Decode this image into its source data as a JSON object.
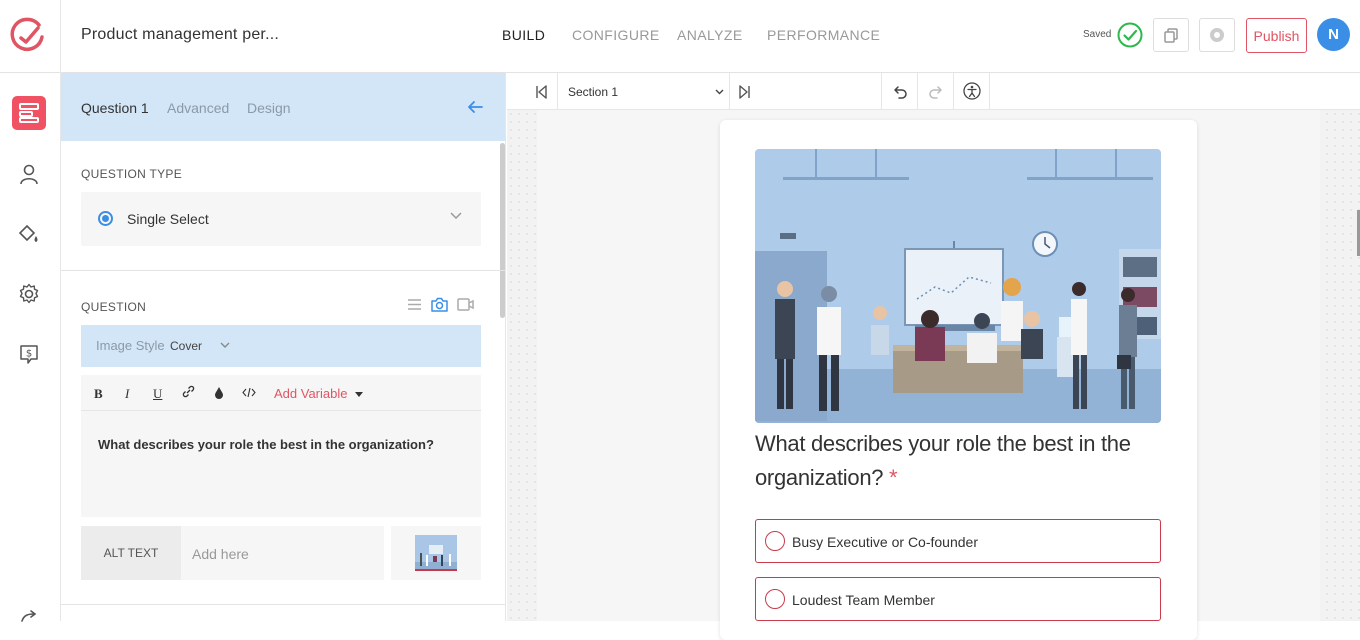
{
  "header": {
    "form_title": "Product management per...",
    "nav": [
      {
        "label": "BUILD",
        "active": true
      },
      {
        "label": "CONFIGURE",
        "active": false
      },
      {
        "label": "ANALYZE",
        "active": false
      },
      {
        "label": "PERFORMANCE",
        "active": false
      }
    ],
    "saved_label": "Saved",
    "publish_label": "Publish",
    "avatar_initial": "N"
  },
  "rail": {
    "items": [
      {
        "icon": "form-builder-icon",
        "active": true
      },
      {
        "icon": "user-icon",
        "active": false
      },
      {
        "icon": "paint-bucket-icon",
        "active": false
      },
      {
        "icon": "gear-icon",
        "active": false
      },
      {
        "icon": "pricing-icon",
        "active": false
      },
      {
        "icon": "share-icon",
        "active": false
      }
    ]
  },
  "panel": {
    "tabs": [
      {
        "label": "Question 1",
        "active": true
      },
      {
        "label": "Advanced",
        "active": false
      },
      {
        "label": "Design",
        "active": false
      }
    ],
    "question_type_label": "QUESTION TYPE",
    "question_type_value": "Single Select",
    "question_label": "QUESTION",
    "image_style_label": "Image Style",
    "image_style_value": "Cover",
    "toolbar": {
      "bold": "B",
      "italic": "I",
      "underline": "U",
      "add_variable": "Add Variable"
    },
    "question_text": "What describes your role the best in the organization?",
    "alt_text_label": "ALT TEXT",
    "alt_text_placeholder": "Add here"
  },
  "canvas_toolbar": {
    "section_label": "Section 1"
  },
  "form": {
    "question_title": "What describes your role the best in the organization?",
    "required_mark": "*",
    "options": [
      "Busy Executive or Co-founder",
      "Loudest Team Member"
    ]
  },
  "colors": {
    "accent_red": "#e05563",
    "accent_blue": "#3a8ee6",
    "panel_tab_bg": "#d3e6f7",
    "saved_green": "#2db84d"
  }
}
